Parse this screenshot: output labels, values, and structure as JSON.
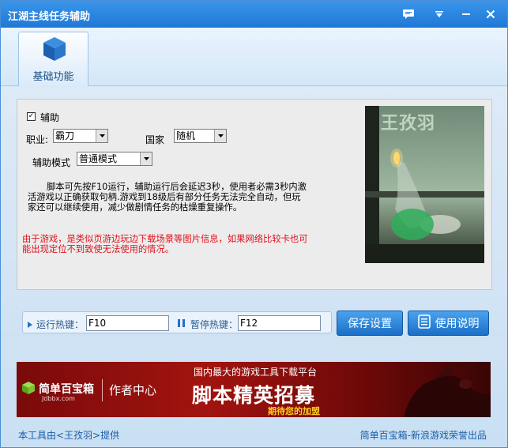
{
  "window": {
    "title": "江湖主线任务辅助"
  },
  "toolbar": {
    "tab_label": "基础功能"
  },
  "form": {
    "assist_label": "辅助",
    "assist_checked": true,
    "job_label": "职业:",
    "job_value": "霸刀",
    "country_label": "国家",
    "country_value": "随机",
    "mode_label": "辅助模式",
    "mode_value": "普通模式"
  },
  "description": "脚本可先按F10运行，辅助运行后会延迟3秒，使用者必需3秒内激活游戏以正确获取句柄.游戏到18级后有部分任务无法完全自动，但玩家还可以继续使用，减少做剧情任务的枯燥重复操作。",
  "warning": "由于游戏，是类似页游边玩边下载场景等图片信息，如果网络比较卡也可能出现定位不到致使无法使用的情况。",
  "photo": {
    "watermark": "王孜羽"
  },
  "hotkeys": {
    "run_label": "运行热键：",
    "run_value": "F10",
    "pause_label": "暂停热键：",
    "pause_value": "F12"
  },
  "buttons": {
    "save": "保存设置",
    "help": "使用说明"
  },
  "banner": {
    "brand": "简单百宝箱",
    "domain": "Jdbbx.com",
    "author_center": "作者中心",
    "tagline": "国内最大的游戏工具下载平台",
    "headline": "脚本精英招募",
    "sub": "期待您的加盟"
  },
  "footer": {
    "left": "本工具由<王孜羽>提供",
    "right": "简单百宝箱-新浪游戏荣誉出品"
  },
  "colors": {
    "titlebar": "#2684e0",
    "accent": "#1b6fc6",
    "warning": "#e0101a",
    "footer_text": "#1a5ea8"
  }
}
